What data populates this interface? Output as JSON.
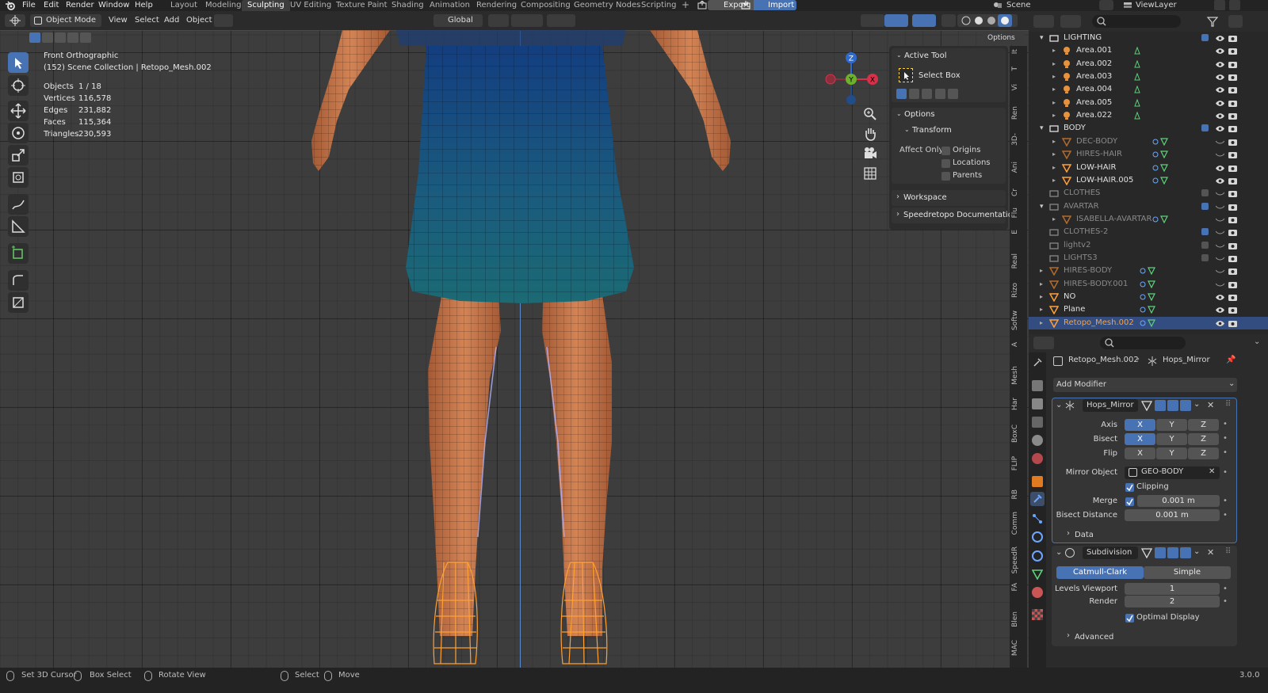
{
  "top_menu": [
    "File",
    "Edit",
    "Render",
    "Window",
    "Help"
  ],
  "workspace_tabs": [
    "Layout",
    "Modeling",
    "Sculpting",
    "UV Editing",
    "Texture Paint",
    "Shading",
    "Animation",
    "Rendering",
    "Compositing",
    "Geometry Nodes",
    "Scripting"
  ],
  "active_workspace": "Sculpting",
  "add_tab": "+",
  "export_label": "Export",
  "import_label": "Import",
  "scene_name": "Scene",
  "viewlayer_name": "ViewLayer",
  "viewport_header": {
    "mode": "Object Mode",
    "menus": [
      "View",
      "Select",
      "Add",
      "Object"
    ],
    "orientation": "Global",
    "options": "Options"
  },
  "overlay": {
    "view_name": "Front Orthographic",
    "collection_line": "(152) Scene Collection | Retopo_Mesh.002",
    "stats": [
      {
        "k": "Objects",
        "v": "1 / 18"
      },
      {
        "k": "Vertices",
        "v": "116,578"
      },
      {
        "k": "Edges",
        "v": "231,882"
      },
      {
        "k": "Faces",
        "v": "115,364"
      },
      {
        "k": "Triangles",
        "v": "230,593"
      }
    ]
  },
  "gizmo": {
    "z": "Z",
    "y": "Y",
    "x": "X"
  },
  "npanel": {
    "active_tool_header": "Active Tool",
    "tool_name": "Select Box",
    "options_header": "Options",
    "transform_header": "Transform",
    "affect_only_label": "Affect Only",
    "affect_options": [
      {
        "label": "Origins",
        "checked": false
      },
      {
        "label": "Locations",
        "checked": false
      },
      {
        "label": "Parents",
        "checked": false
      }
    ],
    "workspace_header": "Workspace",
    "speedretopo_header": "Speedretopo Documentation"
  },
  "side_tabs": [
    "It",
    "T",
    "Vi",
    "Ren",
    "3D-",
    "Ani",
    "Cr",
    "Flu",
    "E",
    "Real",
    "Rizo",
    "Softw",
    "A",
    "Mesh",
    "Har",
    "BoxC",
    "FLIP",
    "RB",
    "Comm",
    "SpeedR",
    "FA",
    "Blen",
    "MAC"
  ],
  "outliner": {
    "rows": [
      {
        "label": "LIGHTING",
        "indent": 0,
        "type": "collection",
        "expand": "open",
        "checked": true,
        "dim": false
      },
      {
        "label": "Area.001",
        "indent": 1,
        "type": "light",
        "expand": "closed",
        "dim": false
      },
      {
        "label": "Area.002",
        "indent": 1,
        "type": "light",
        "expand": "closed",
        "dim": false
      },
      {
        "label": "Area.003",
        "indent": 1,
        "type": "light",
        "expand": "closed",
        "dim": false
      },
      {
        "label": "Area.004",
        "indent": 1,
        "type": "light",
        "expand": "closed",
        "dim": false
      },
      {
        "label": "Area.005",
        "indent": 1,
        "type": "light",
        "expand": "closed",
        "dim": false
      },
      {
        "label": "Area.022",
        "indent": 1,
        "type": "light",
        "expand": "closed",
        "dim": false
      },
      {
        "label": "BODY",
        "indent": 0,
        "type": "collection",
        "expand": "open",
        "checked": true,
        "dim": false
      },
      {
        "label": "DEC-BODY",
        "indent": 1,
        "type": "mesh",
        "expand": "closed",
        "dim": true
      },
      {
        "label": "HIRES-HAIR",
        "indent": 1,
        "type": "mesh",
        "expand": "closed",
        "dim": true
      },
      {
        "label": "LOW-HAIR",
        "indent": 1,
        "type": "mesh",
        "expand": "closed",
        "dim": false
      },
      {
        "label": "LOW-HAIR.005",
        "indent": 1,
        "type": "mesh",
        "expand": "closed",
        "dim": false
      },
      {
        "label": "CLOTHES",
        "indent": 0,
        "type": "collection",
        "expand": "none",
        "checked": false,
        "dim": true
      },
      {
        "label": "AVARTAR",
        "indent": 0,
        "type": "collection",
        "expand": "open",
        "checked": true,
        "dim": true
      },
      {
        "label": "ISABELLA-AVARTAR",
        "indent": 1,
        "type": "mesh",
        "expand": "closed",
        "dim": true
      },
      {
        "label": "CLOTHES-2",
        "indent": 0,
        "type": "collection",
        "expand": "none",
        "checked": true,
        "dim": true
      },
      {
        "label": "lightv2",
        "indent": 0,
        "type": "collection",
        "expand": "none",
        "checked": false,
        "dim": true
      },
      {
        "label": "LIGHTS3",
        "indent": 0,
        "type": "collection",
        "expand": "none",
        "checked": false,
        "dim": true
      },
      {
        "label": "HIRES-BODY",
        "indent": 0,
        "type": "mesh",
        "expand": "closed",
        "dim": true
      },
      {
        "label": "HIRES-BODY.001",
        "indent": 0,
        "type": "mesh",
        "expand": "closed",
        "dim": true
      },
      {
        "label": "NO",
        "indent": 0,
        "type": "mesh",
        "expand": "closed",
        "dim": false
      },
      {
        "label": "Plane",
        "indent": 0,
        "type": "mesh",
        "expand": "closed",
        "dim": false
      },
      {
        "label": "Retopo_Mesh.002",
        "indent": 0,
        "type": "mesh",
        "expand": "closed",
        "dim": false,
        "selected": true
      }
    ]
  },
  "properties": {
    "breadcrumb_object": "Retopo_Mesh.002",
    "breadcrumb_modifier": "Hops_Mirror",
    "add_modifier": "Add Modifier",
    "mirror": {
      "name": "Hops_Mirror",
      "axis_label": "Axis",
      "bisect_label": "Bisect",
      "flip_label": "Flip",
      "axes": [
        "X",
        "Y",
        "Z"
      ],
      "axis_on": [
        true,
        false,
        false
      ],
      "bisect_on": [
        true,
        false,
        false
      ],
      "flip_on": [
        false,
        false,
        false
      ],
      "mirror_object_label": "Mirror Object",
      "mirror_object": "GEO-BODY",
      "clipping_label": "Clipping",
      "clipping": true,
      "merge_label": "Merge",
      "merge_value": "0.001 m",
      "bisect_distance_label": "Bisect Distance",
      "bisect_distance": "0.001 m",
      "data_label": "Data"
    },
    "subdivision": {
      "name": "Subdivision",
      "method_a": "Catmull-Clark",
      "method_b": "Simple",
      "levels_viewport_label": "Levels Viewport",
      "levels_viewport": "1",
      "render_label": "Render",
      "render": "2",
      "optimal_label": "Optimal Display",
      "optimal": true,
      "advanced_label": "Advanced"
    }
  },
  "status": {
    "set_cursor": "Set 3D Cursor",
    "box_select": "Box Select",
    "rotate_view": "Rotate View",
    "select": "Select",
    "move": "Move",
    "version": "3.0.0"
  },
  "colors": {
    "accent": "#4772b3",
    "selection": "#334d80",
    "highlight_orange": "#ffa033",
    "grid_bg": "#3d3d3d"
  }
}
